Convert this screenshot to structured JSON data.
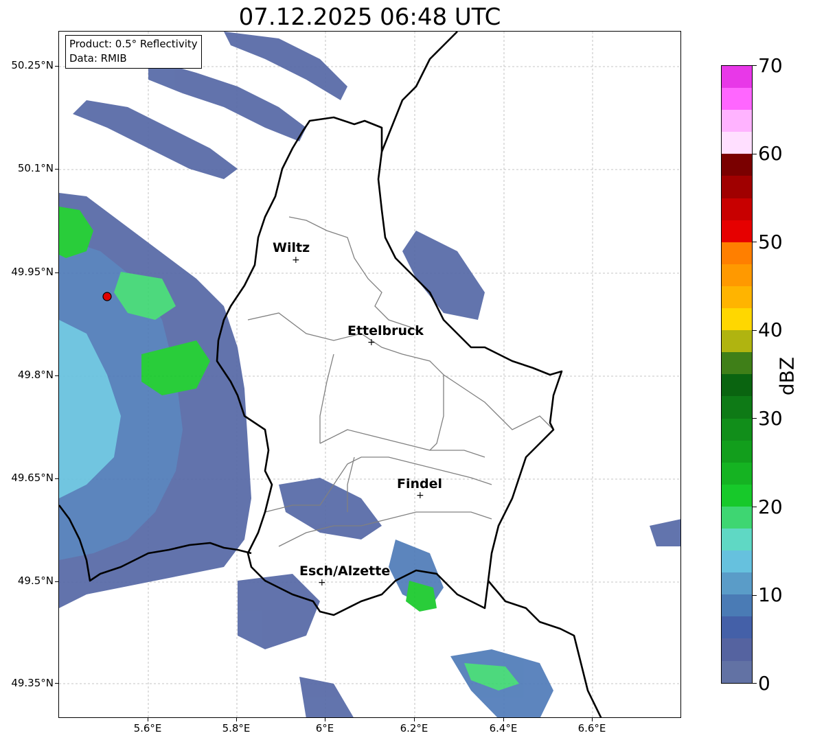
{
  "title": "07.12.2025 06:48 UTC",
  "infobox": {
    "product": "Product: 0.5° Reflectivity",
    "data": "Data: RMIB"
  },
  "axes": {
    "lat_labels": [
      "50.25°N",
      "50.1°N",
      "49.95°N",
      "49.8°N",
      "49.65°N",
      "49.5°N",
      "49.35°N"
    ],
    "lon_labels": [
      "5.6°E",
      "5.8°E",
      "6°E",
      "6.2°E",
      "6.4°E",
      "6.6°E"
    ],
    "grid": true
  },
  "cities": [
    {
      "name": "Wiltz",
      "marker": "+"
    },
    {
      "name": "Ettelbruck",
      "marker": "+"
    },
    {
      "name": "Findel",
      "marker": "+"
    },
    {
      "name": "Esch/Alzette",
      "marker": "+"
    }
  ],
  "colorbar": {
    "unit": "dBZ",
    "tick_labels": [
      "0",
      "10",
      "20",
      "30",
      "40",
      "50",
      "60",
      "70"
    ],
    "colors": [
      "#6272a4",
      "#5563a0",
      "#4460a8",
      "#4a7bb5",
      "#5a9cc8",
      "#66c1de",
      "#5fd8c4",
      "#3ed672",
      "#17c92a",
      "#15b322",
      "#129e1c",
      "#118e1a",
      "#0e7a16",
      "#0a6410",
      "#3f7f18",
      "#b0b410",
      "#ffd700",
      "#ffb400",
      "#ff9900",
      "#ff7f00",
      "#e60000",
      "#c80000",
      "#a00000",
      "#7a0000",
      "#ffdfff",
      "#ffb3ff",
      "#ff66ff",
      "#e838e8"
    ]
  },
  "colors": {
    "border_national": "#000000",
    "border_canton": "#808080",
    "radar_site": "#e00000"
  }
}
